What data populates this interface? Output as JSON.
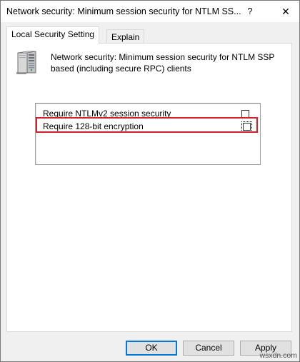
{
  "window": {
    "title": "Network security: Minimum session security for NTLM SS...",
    "help_glyph": "?",
    "close_glyph": "✕"
  },
  "tabs": [
    {
      "label": "Local Security Setting",
      "active": true
    },
    {
      "label": "Explain",
      "active": false
    }
  ],
  "policy": {
    "icon": "server-icon",
    "description": "Network security: Minimum session security for NTLM SSP based (including secure RPC) clients"
  },
  "options": [
    {
      "label": "Require NTLMv2 session security",
      "checked": false
    },
    {
      "label": "Require 128-bit encryption",
      "checked": false,
      "focused": true,
      "highlighted": true
    }
  ],
  "highlight_color": "#d4202a",
  "buttons": {
    "ok": "OK",
    "cancel": "Cancel",
    "apply": "Apply"
  },
  "watermark": "wsxdn.com"
}
